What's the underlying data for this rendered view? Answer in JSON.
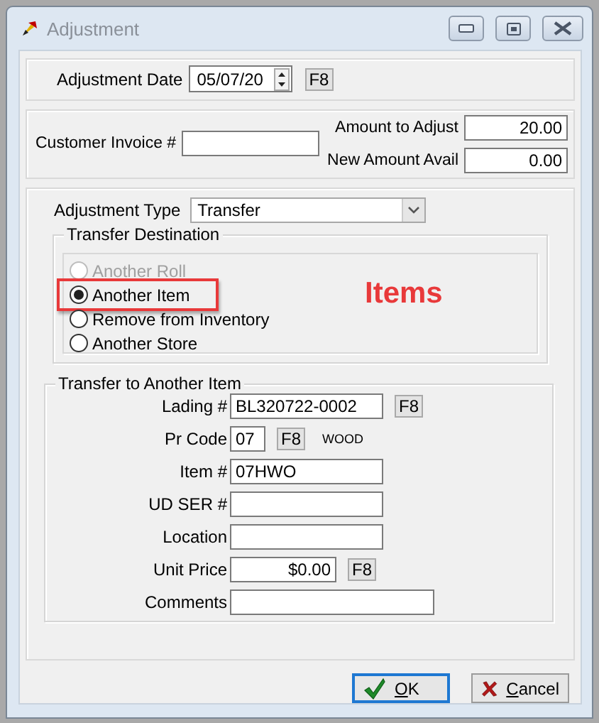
{
  "window": {
    "title": "Adjustment"
  },
  "adjustment_date": {
    "label": "Adjustment Date",
    "value": "05/07/20",
    "lookup": "F8"
  },
  "invoice": {
    "label": "Customer Invoice #"
  },
  "amounts": [
    {
      "label": "Amount to Adjust",
      "value": "20.00"
    },
    {
      "label": "New Amount Avail",
      "value": "0.00"
    }
  ],
  "adjustment_type": {
    "label": "Adjustment Type",
    "value": "Transfer"
  },
  "transfer_destination": {
    "title": "Transfer Destination",
    "options": [
      {
        "label": "Another Roll",
        "selected": false,
        "disabled": true
      },
      {
        "label": "Another Item",
        "selected": true,
        "disabled": false
      },
      {
        "label": "Remove from Inventory",
        "selected": false,
        "disabled": false
      },
      {
        "label": "Another Store",
        "selected": false,
        "disabled": false
      }
    ]
  },
  "annotation": {
    "text": "Items"
  },
  "transfer_item": {
    "title": "Transfer to Another Item",
    "fields": [
      {
        "label": "Lading #",
        "value": "BL320722-0002",
        "lookup": "F8",
        "kind": "text"
      },
      {
        "label": "Pr Code",
        "value": "07",
        "lookup": "F8",
        "note": "WOOD",
        "kind": "short"
      },
      {
        "label": "Item #",
        "value": "07HWO",
        "kind": "text"
      },
      {
        "label": "UD SER #",
        "kind": "text"
      },
      {
        "label": "Location",
        "kind": "text"
      },
      {
        "label": "Unit Price",
        "value": "$0.00",
        "lookup": "F8",
        "kind": "money"
      },
      {
        "label": "Comments",
        "kind": "wide"
      }
    ]
  },
  "buttons": [
    {
      "label": "OK",
      "kind": "ok",
      "default": true
    },
    {
      "label": "Cancel",
      "kind": "cancel",
      "default": false
    }
  ]
}
